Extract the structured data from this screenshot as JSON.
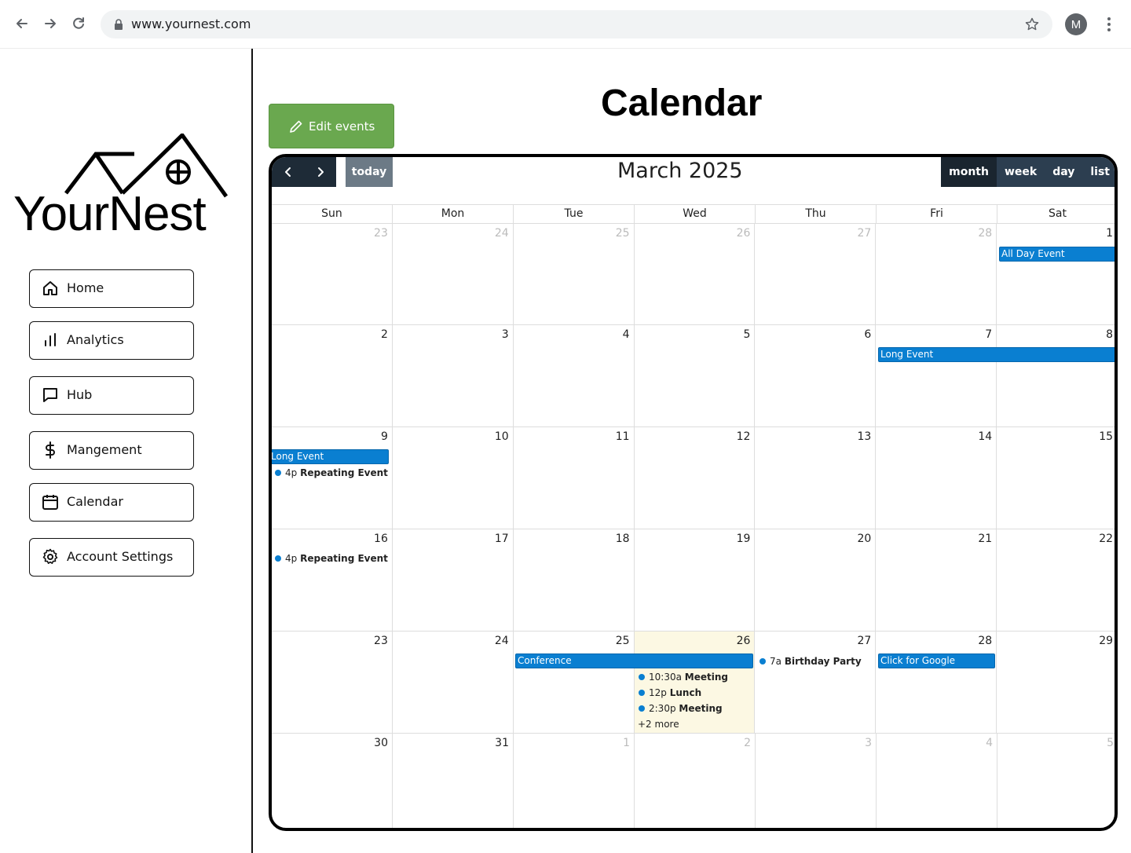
{
  "browser": {
    "url": "www.yournest.com",
    "avatar_letter": "M"
  },
  "sidebar": {
    "logo_text": "YourNest",
    "items": [
      {
        "label": "Home",
        "icon": "home-icon"
      },
      {
        "label": "Analytics",
        "icon": "bar-chart-icon"
      },
      {
        "label": "Hub",
        "icon": "chat-bubble-icon"
      },
      {
        "label": "Mangement",
        "icon": "dollar-icon"
      },
      {
        "label": "Calendar",
        "icon": "calendar-icon"
      },
      {
        "label": "Account Settings",
        "icon": "gear-icon"
      }
    ]
  },
  "main": {
    "title": "Calendar",
    "edit_button": "Edit events"
  },
  "calendar": {
    "title": "March 2025",
    "today_label": "today",
    "views": [
      "month",
      "week",
      "day",
      "list"
    ],
    "active_view": "month",
    "dow": [
      "Sun",
      "Mon",
      "Tue",
      "Wed",
      "Thu",
      "Fri",
      "Sat"
    ],
    "weeks": [
      [
        "23",
        "24",
        "25",
        "26",
        "27",
        "28",
        "1"
      ],
      [
        "2",
        "3",
        "4",
        "5",
        "6",
        "7",
        "8"
      ],
      [
        "9",
        "10",
        "11",
        "12",
        "13",
        "14",
        "15"
      ],
      [
        "16",
        "17",
        "18",
        "19",
        "20",
        "21",
        "22"
      ],
      [
        "23",
        "24",
        "25",
        "26",
        "27",
        "28",
        "29"
      ],
      [
        "30",
        "31",
        "1",
        "2",
        "3",
        "4",
        "5"
      ]
    ],
    "events": {
      "all_day": "All Day Event",
      "long_event_1": "Long Event",
      "long_event_2": "Long Event",
      "repeating_1": {
        "time": "4p",
        "title": "Repeating Event"
      },
      "repeating_2": {
        "time": "4p",
        "title": "Repeating Event"
      },
      "conference": "Conference",
      "meeting_1": {
        "time": "10:30a",
        "title": "Meeting"
      },
      "lunch": {
        "time": "12p",
        "title": "Lunch"
      },
      "meeting_2": {
        "time": "2:30p",
        "title": "Meeting"
      },
      "more": "+2 more",
      "birthday": {
        "time": "7a",
        "title": "Birthday Party"
      },
      "google": "Click for Google"
    },
    "colors": {
      "event": "#0a7fd1",
      "today_bg": "#fcf8e3",
      "toolbar": "#2c3e50"
    }
  }
}
